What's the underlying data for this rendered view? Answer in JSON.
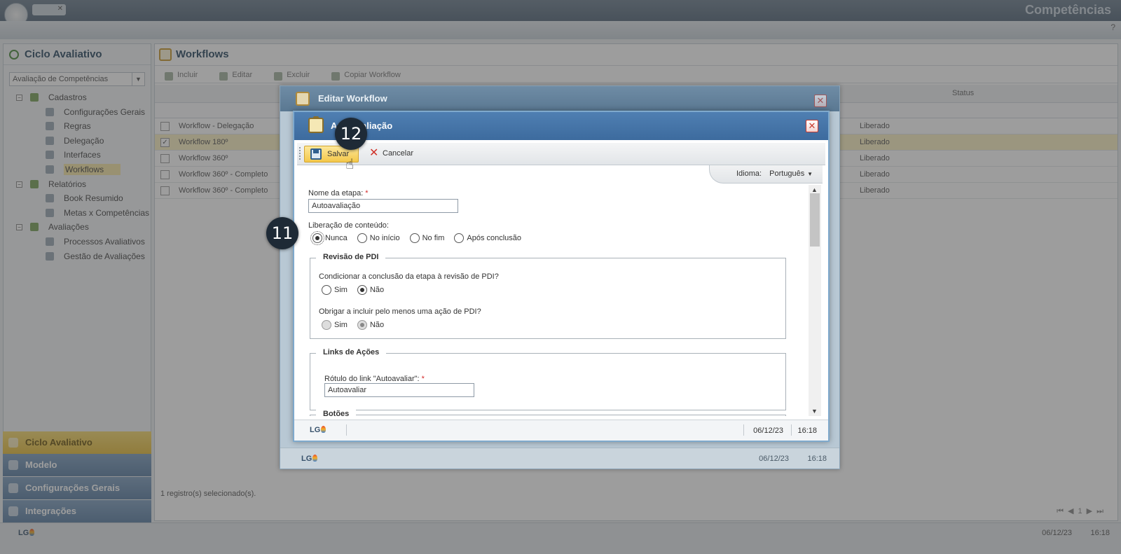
{
  "app": {
    "title": "Competências",
    "help": "?"
  },
  "left_panel": {
    "title": "Ciclo Avaliativo",
    "select_value": "Avaliação de Competências",
    "tree": [
      {
        "label": "Cadastros",
        "level": 1,
        "toggle": "−"
      },
      {
        "label": "Configurações Gerais",
        "level": 2
      },
      {
        "label": "Regras",
        "level": 2
      },
      {
        "label": "Delegação",
        "level": 2
      },
      {
        "label": "Interfaces",
        "level": 2
      },
      {
        "label": "Workflows",
        "level": 2,
        "selected": true
      },
      {
        "label": "Relatórios",
        "level": 1,
        "toggle": "−"
      },
      {
        "label": "Book Resumido",
        "level": 2
      },
      {
        "label": "Metas x Competências",
        "level": 2
      },
      {
        "label": "Avaliações",
        "level": 1,
        "toggle": "−"
      },
      {
        "label": "Processos Avaliativos",
        "level": 2
      },
      {
        "label": "Gestão de Avaliações",
        "level": 2
      }
    ],
    "accordion": [
      "Ciclo Avaliativo",
      "Modelo",
      "Configurações Gerais",
      "Integrações"
    ]
  },
  "main_panel": {
    "title": "Workflows",
    "toolbar": [
      "Incluir",
      "Editar",
      "Excluir",
      "Copiar Workflow"
    ],
    "status_header": "Status",
    "rows": [
      {
        "name": "Workflow - Delegação",
        "status": "Liberado",
        "checked": false
      },
      {
        "name": "Workflow 180º",
        "status": "Liberado",
        "checked": true
      },
      {
        "name": "Workflow 360º",
        "status": "Liberado",
        "checked": false
      },
      {
        "name": "Workflow 360º - Completo",
        "status": "Liberado",
        "checked": false
      },
      {
        "name": "Workflow 360º - Completo",
        "status": "Liberado",
        "checked": false
      }
    ],
    "footer_text": "1 registro(s) selecionado(s).",
    "bottom_date": "06/12/23",
    "bottom_time": "16:18"
  },
  "outer_dialog": {
    "title": "Editar Workflow",
    "date": "06/12/23",
    "time": "16:18"
  },
  "dialog": {
    "title": "Autoavaliação",
    "toolbar": {
      "save_label": "Salvar",
      "cancel_label": "Cancelar"
    },
    "language": {
      "label": "Idioma:",
      "value": "Português"
    },
    "step_name": {
      "label": "Nome da etapa:",
      "value": "Autoavaliação",
      "required": "*"
    },
    "content_release": {
      "label": "Liberação de conteúdo:",
      "options": [
        "Nunca",
        "No início",
        "No fim",
        "Após conclusão"
      ],
      "selected": "Nunca"
    },
    "pdi_review": {
      "legend": "Revisão de PDI",
      "q1": {
        "label": "Condicionar a conclusão da etapa à revisão de PDI?",
        "options": [
          "Sim",
          "Não"
        ],
        "selected": "Não"
      },
      "q2": {
        "label": "Obrigar a incluir pelo menos uma ação de PDI?",
        "options": [
          "Sim",
          "Não"
        ],
        "selected": "Não"
      }
    },
    "action_links": {
      "legend": "Links de Ações",
      "link_label": {
        "label": "Rótulo do link \"Autoavaliar\":",
        "value": "Autoavaliar",
        "required": "*"
      }
    },
    "buttons_section": {
      "legend": "Botões"
    },
    "footer": {
      "logo": "LG",
      "date": "06/12/23",
      "time": "16:18"
    }
  },
  "step_badges": {
    "save": "12",
    "release": "11"
  }
}
